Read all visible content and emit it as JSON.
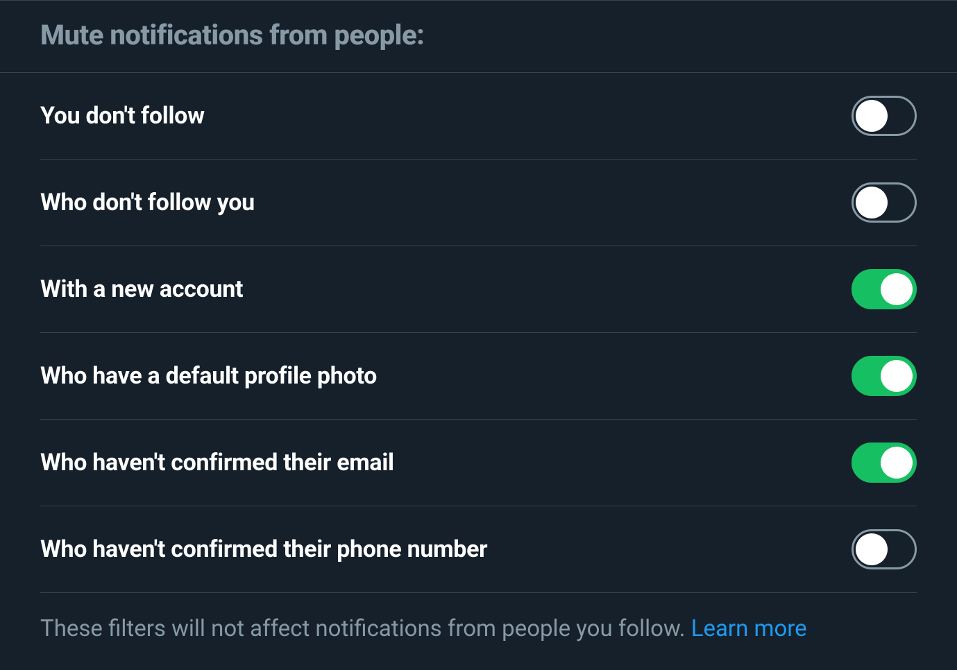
{
  "section": {
    "title": "Mute notifications from people:"
  },
  "settings": [
    {
      "label": "You don't follow",
      "enabled": false
    },
    {
      "label": "Who don't follow you",
      "enabled": false
    },
    {
      "label": "With a new account",
      "enabled": true
    },
    {
      "label": "Who have a default profile photo",
      "enabled": true
    },
    {
      "label": "Who haven't confirmed their email",
      "enabled": true
    },
    {
      "label": "Who haven't confirmed their phone number",
      "enabled": false
    }
  ],
  "footer": {
    "note": "These filters will not affect notifications from people you follow. ",
    "learn_more": "Learn more"
  }
}
